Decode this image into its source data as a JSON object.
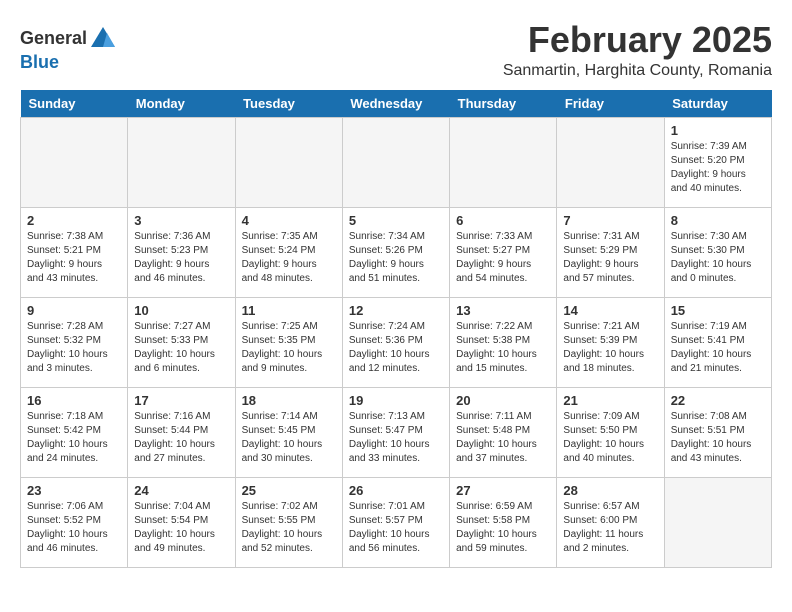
{
  "header": {
    "logo_general": "General",
    "logo_blue": "Blue",
    "month_year": "February 2025",
    "location": "Sanmartin, Harghita County, Romania"
  },
  "weekdays": [
    "Sunday",
    "Monday",
    "Tuesday",
    "Wednesday",
    "Thursday",
    "Friday",
    "Saturday"
  ],
  "weeks": [
    [
      {
        "day": "",
        "info": ""
      },
      {
        "day": "",
        "info": ""
      },
      {
        "day": "",
        "info": ""
      },
      {
        "day": "",
        "info": ""
      },
      {
        "day": "",
        "info": ""
      },
      {
        "day": "",
        "info": ""
      },
      {
        "day": "1",
        "info": "Sunrise: 7:39 AM\nSunset: 5:20 PM\nDaylight: 9 hours\nand 40 minutes."
      }
    ],
    [
      {
        "day": "2",
        "info": "Sunrise: 7:38 AM\nSunset: 5:21 PM\nDaylight: 9 hours\nand 43 minutes."
      },
      {
        "day": "3",
        "info": "Sunrise: 7:36 AM\nSunset: 5:23 PM\nDaylight: 9 hours\nand 46 minutes."
      },
      {
        "day": "4",
        "info": "Sunrise: 7:35 AM\nSunset: 5:24 PM\nDaylight: 9 hours\nand 48 minutes."
      },
      {
        "day": "5",
        "info": "Sunrise: 7:34 AM\nSunset: 5:26 PM\nDaylight: 9 hours\nand 51 minutes."
      },
      {
        "day": "6",
        "info": "Sunrise: 7:33 AM\nSunset: 5:27 PM\nDaylight: 9 hours\nand 54 minutes."
      },
      {
        "day": "7",
        "info": "Sunrise: 7:31 AM\nSunset: 5:29 PM\nDaylight: 9 hours\nand 57 minutes."
      },
      {
        "day": "8",
        "info": "Sunrise: 7:30 AM\nSunset: 5:30 PM\nDaylight: 10 hours\nand 0 minutes."
      }
    ],
    [
      {
        "day": "9",
        "info": "Sunrise: 7:28 AM\nSunset: 5:32 PM\nDaylight: 10 hours\nand 3 minutes."
      },
      {
        "day": "10",
        "info": "Sunrise: 7:27 AM\nSunset: 5:33 PM\nDaylight: 10 hours\nand 6 minutes."
      },
      {
        "day": "11",
        "info": "Sunrise: 7:25 AM\nSunset: 5:35 PM\nDaylight: 10 hours\nand 9 minutes."
      },
      {
        "day": "12",
        "info": "Sunrise: 7:24 AM\nSunset: 5:36 PM\nDaylight: 10 hours\nand 12 minutes."
      },
      {
        "day": "13",
        "info": "Sunrise: 7:22 AM\nSunset: 5:38 PM\nDaylight: 10 hours\nand 15 minutes."
      },
      {
        "day": "14",
        "info": "Sunrise: 7:21 AM\nSunset: 5:39 PM\nDaylight: 10 hours\nand 18 minutes."
      },
      {
        "day": "15",
        "info": "Sunrise: 7:19 AM\nSunset: 5:41 PM\nDaylight: 10 hours\nand 21 minutes."
      }
    ],
    [
      {
        "day": "16",
        "info": "Sunrise: 7:18 AM\nSunset: 5:42 PM\nDaylight: 10 hours\nand 24 minutes."
      },
      {
        "day": "17",
        "info": "Sunrise: 7:16 AM\nSunset: 5:44 PM\nDaylight: 10 hours\nand 27 minutes."
      },
      {
        "day": "18",
        "info": "Sunrise: 7:14 AM\nSunset: 5:45 PM\nDaylight: 10 hours\nand 30 minutes."
      },
      {
        "day": "19",
        "info": "Sunrise: 7:13 AM\nSunset: 5:47 PM\nDaylight: 10 hours\nand 33 minutes."
      },
      {
        "day": "20",
        "info": "Sunrise: 7:11 AM\nSunset: 5:48 PM\nDaylight: 10 hours\nand 37 minutes."
      },
      {
        "day": "21",
        "info": "Sunrise: 7:09 AM\nSunset: 5:50 PM\nDaylight: 10 hours\nand 40 minutes."
      },
      {
        "day": "22",
        "info": "Sunrise: 7:08 AM\nSunset: 5:51 PM\nDaylight: 10 hours\nand 43 minutes."
      }
    ],
    [
      {
        "day": "23",
        "info": "Sunrise: 7:06 AM\nSunset: 5:52 PM\nDaylight: 10 hours\nand 46 minutes."
      },
      {
        "day": "24",
        "info": "Sunrise: 7:04 AM\nSunset: 5:54 PM\nDaylight: 10 hours\nand 49 minutes."
      },
      {
        "day": "25",
        "info": "Sunrise: 7:02 AM\nSunset: 5:55 PM\nDaylight: 10 hours\nand 52 minutes."
      },
      {
        "day": "26",
        "info": "Sunrise: 7:01 AM\nSunset: 5:57 PM\nDaylight: 10 hours\nand 56 minutes."
      },
      {
        "day": "27",
        "info": "Sunrise: 6:59 AM\nSunset: 5:58 PM\nDaylight: 10 hours\nand 59 minutes."
      },
      {
        "day": "28",
        "info": "Sunrise: 6:57 AM\nSunset: 6:00 PM\nDaylight: 11 hours\nand 2 minutes."
      },
      {
        "day": "",
        "info": ""
      }
    ]
  ]
}
